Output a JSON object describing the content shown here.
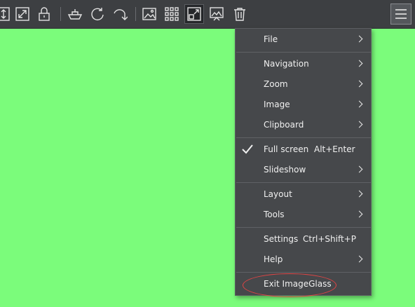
{
  "colors": {
    "background": "#7bfc7b",
    "toolbar": "#3d3f42",
    "menu": "#46484b",
    "highlight_oval": "#e24444"
  },
  "toolbar": {
    "buttons": [
      {
        "icon": "fit-height-icon"
      },
      {
        "icon": "expand-icon"
      },
      {
        "icon": "lock-icon"
      },
      {
        "icon": "ferry-icon"
      },
      {
        "icon": "refresh-icon"
      },
      {
        "icon": "rotate-icon"
      },
      {
        "icon": "image-icon"
      },
      {
        "icon": "thumbnails-grid-icon"
      },
      {
        "icon": "fullscreen-icon"
      },
      {
        "icon": "slideshow-icon"
      },
      {
        "icon": "trash-icon"
      }
    ],
    "main_menu_icon": "hamburger-icon"
  },
  "menu": {
    "items": [
      {
        "label": "File",
        "submenu": true
      },
      {
        "label": "Navigation",
        "submenu": true
      },
      {
        "label": "Zoom",
        "submenu": true
      },
      {
        "label": "Image",
        "submenu": true
      },
      {
        "label": "Clipboard",
        "submenu": true
      },
      {
        "label": "Full screen",
        "shortcut": "Alt+Enter",
        "checked": true
      },
      {
        "label": "Slideshow",
        "submenu": true
      },
      {
        "label": "Layout",
        "submenu": true
      },
      {
        "label": "Tools",
        "submenu": true
      },
      {
        "label": "Settings",
        "shortcut": "Ctrl+Shift+P"
      },
      {
        "label": "Help",
        "submenu": true
      },
      {
        "label": "Exit ImageGlass"
      }
    ]
  }
}
